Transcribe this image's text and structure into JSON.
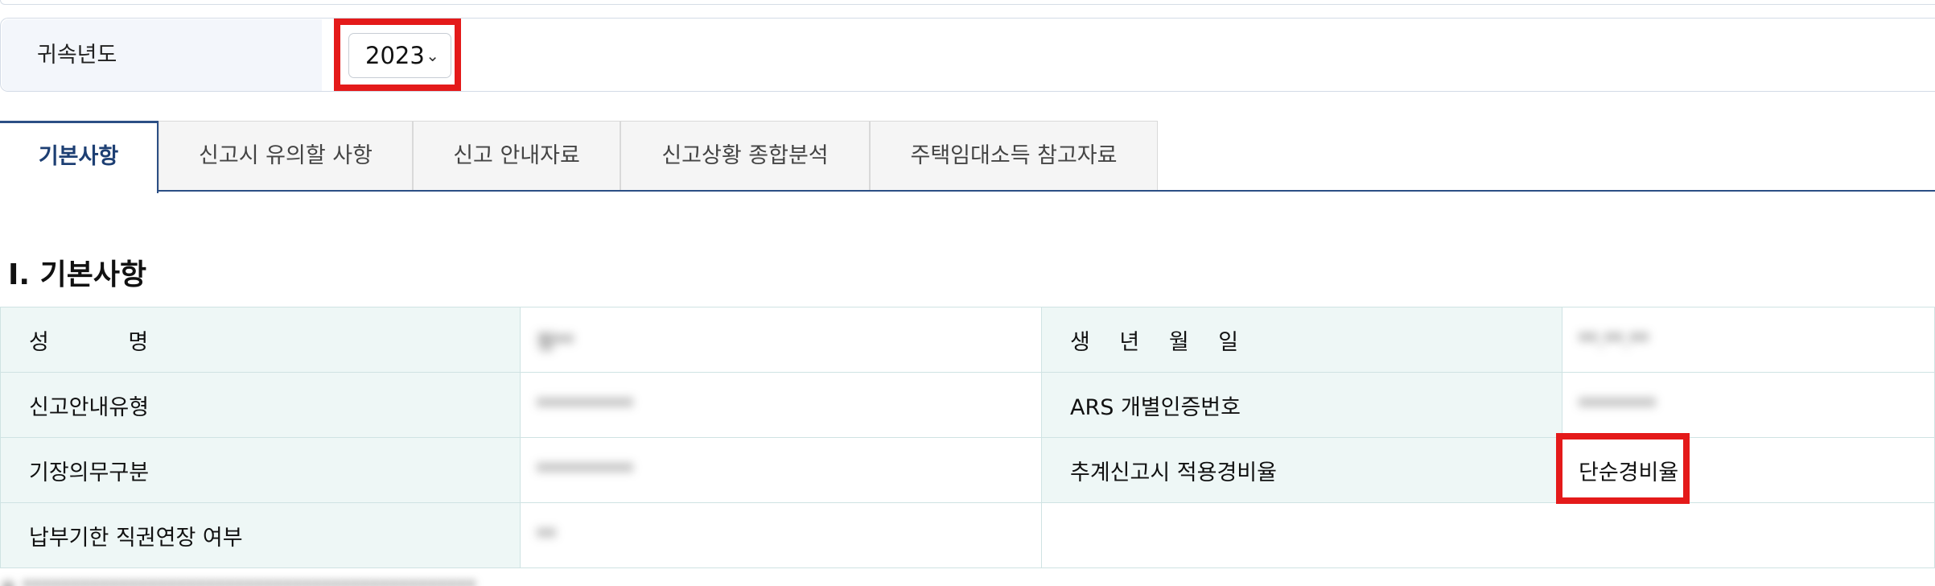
{
  "year_filter": {
    "label": "귀속년도",
    "selected": "2023"
  },
  "tabs": [
    {
      "label": "기본사항",
      "active": true
    },
    {
      "label": "신고시 유의할 사항",
      "active": false
    },
    {
      "label": "신고 안내자료",
      "active": false
    },
    {
      "label": "신고상황 종합분석",
      "active": false
    },
    {
      "label": "주택임대소득 참고자료",
      "active": false
    }
  ],
  "section_title": "Ⅰ. 기본사항",
  "basic_info": {
    "name_label": "성 명",
    "name_value": "정**",
    "birth_label": "생 년 월 일",
    "birth_value": "**.**.**",
    "guide_type_label": "신고안내유형",
    "guide_type_value": "**********",
    "ars_label": "ARS 개별인증번호",
    "ars_value": "********",
    "bookkeeping_label": "기장의무구분",
    "bookkeeping_value": "**********",
    "expense_rate_label": "추계신고시 적용경비율",
    "expense_rate_value": "단순경비율",
    "extension_label": "납부기한 직권연장 여부",
    "extension_value": "**"
  },
  "bottom_note": "※ ***********************************************",
  "colors": {
    "highlight": "#e41a1a",
    "tab_accent": "#2c4f85",
    "header_bg": "#eef7f6"
  }
}
